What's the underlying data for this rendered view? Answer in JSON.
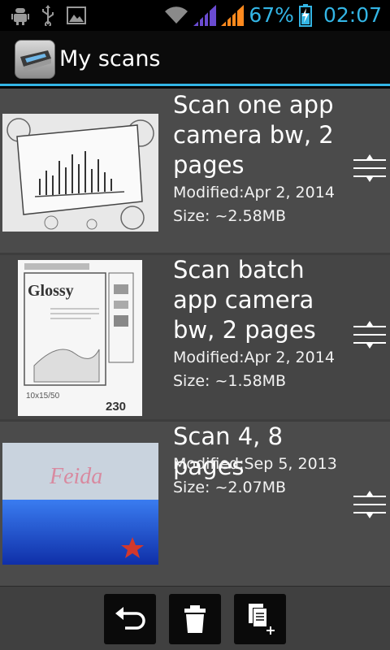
{
  "status_bar": {
    "battery": "67%",
    "time": "02:07",
    "icons": [
      "android-debug-icon",
      "usb-icon",
      "image-icon",
      "wifi-icon",
      "signal-icon",
      "signal-icon",
      "battery-charging-icon"
    ]
  },
  "app_bar": {
    "title": "My scans",
    "icon": "scanner-app-icon"
  },
  "scans": [
    {
      "title": "Scan one app camera bw, 2 pages",
      "modified": "Modified:Apr 2, 2014",
      "size": "Size: ~2.58MB"
    },
    {
      "title": "Scan batch app camera bw, 2 pages",
      "modified": "Modified:Apr 2, 2014",
      "size": "Size: ~1.58MB"
    },
    {
      "title": "Scan 4, 8 pages",
      "modified": "Modified:Sep 5, 2013",
      "size": "Size: ~2.07MB"
    }
  ],
  "bottom_bar": {
    "buttons": [
      "undo-icon",
      "delete-icon",
      "new-document-icon"
    ]
  },
  "colors": {
    "accent": "#33b5e5",
    "list_bg": "#4b4b4b",
    "bottom_bar_bg": "#404040"
  }
}
